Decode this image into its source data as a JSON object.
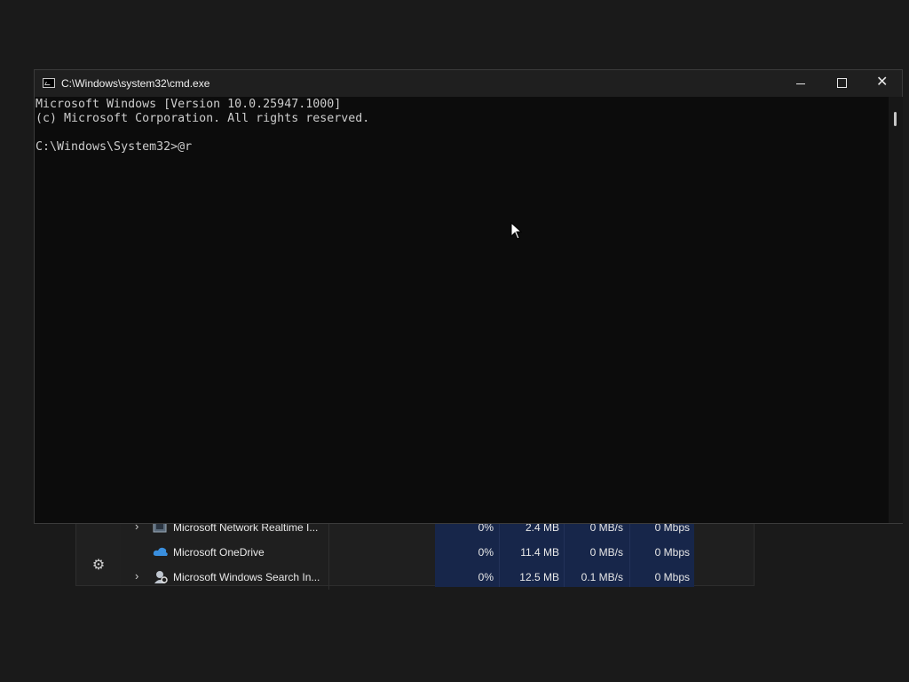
{
  "task_manager": {
    "rows": [
      {
        "name": "Microsoft Network Realtime I...",
        "cpu": "0%",
        "memory": "2.4 MB",
        "disk": "0 MB/s",
        "network": "0 Mbps",
        "expandable": true,
        "icon": "network-inspection-icon"
      },
      {
        "name": "Microsoft OneDrive",
        "cpu": "0%",
        "memory": "11.4 MB",
        "disk": "0 MB/s",
        "network": "0 Mbps",
        "expandable": false,
        "icon": "onedrive-cloud-icon"
      },
      {
        "name": "Microsoft Windows Search In...",
        "cpu": "0%",
        "memory": "12.5 MB",
        "disk": "0.1 MB/s",
        "network": "0 Mbps",
        "expandable": true,
        "icon": "search-indexer-icon"
      }
    ],
    "settings_icon": "gear-icon"
  },
  "cmd_window": {
    "title": "C:\\Windows\\system32\\cmd.exe",
    "controls": {
      "minimize": "minimize-icon",
      "maximize": "maximize-icon",
      "close": "close-icon"
    },
    "lines": [
      "Microsoft Windows [Version 10.0.25947.1000]",
      "(c) Microsoft Corporation. All rights reserved.",
      "",
      "C:\\Windows\\System32>@r"
    ]
  },
  "colors": {
    "desktop_bg": "#1a1a1a",
    "console_bg": "#0c0c0c",
    "console_text": "#cccccc",
    "titlebar_bg": "#1f1f1f",
    "highlight_col": "#17264a"
  }
}
